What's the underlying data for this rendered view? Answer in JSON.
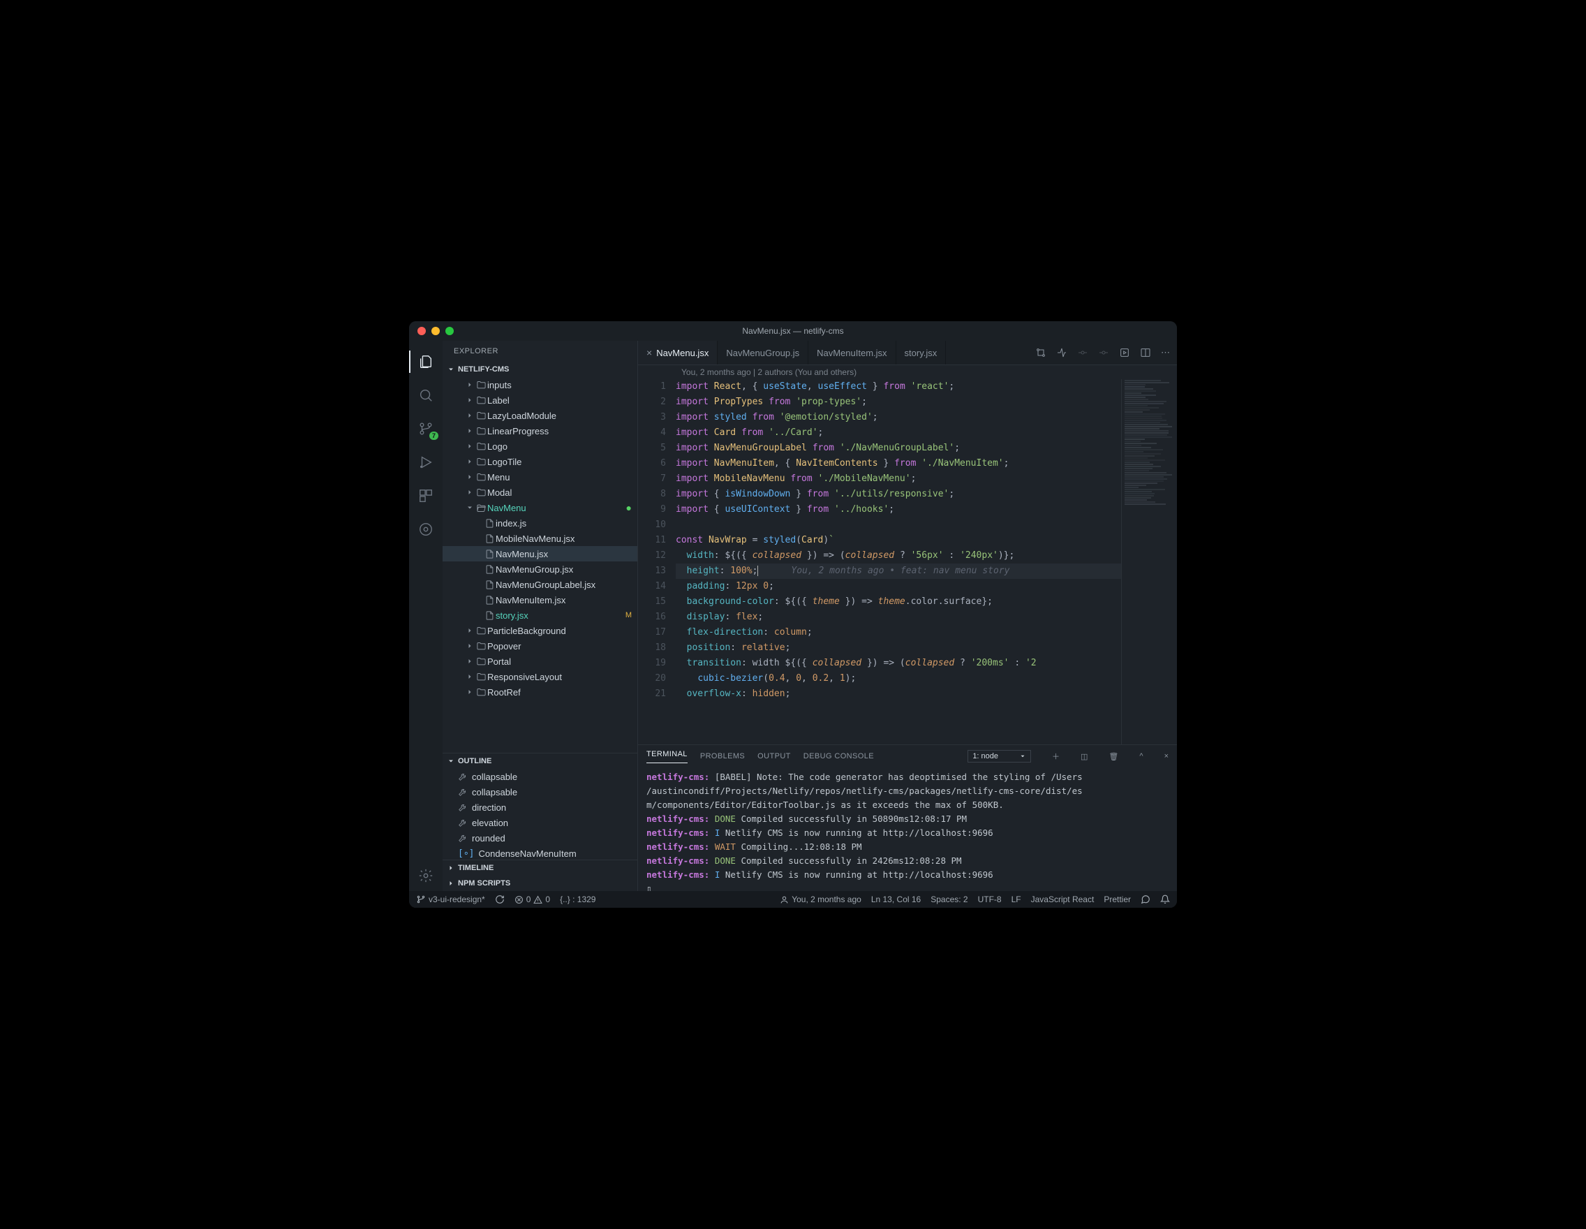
{
  "window": {
    "title": "NavMenu.jsx — netlify-cms"
  },
  "sidebar": {
    "title": "EXPLORER",
    "project": "NETLIFY-CMS",
    "tree": [
      {
        "depth": 2,
        "kind": "folder",
        "label": "inputs",
        "expanded": false,
        "lower": true
      },
      {
        "depth": 2,
        "kind": "folder",
        "label": "Label",
        "expanded": false
      },
      {
        "depth": 2,
        "kind": "folder",
        "label": "LazyLoadModule",
        "expanded": false
      },
      {
        "depth": 2,
        "kind": "folder",
        "label": "LinearProgress",
        "expanded": false
      },
      {
        "depth": 2,
        "kind": "folder",
        "label": "Logo",
        "expanded": false
      },
      {
        "depth": 2,
        "kind": "folder",
        "label": "LogoTile",
        "expanded": false
      },
      {
        "depth": 2,
        "kind": "folder",
        "label": "Menu",
        "expanded": false
      },
      {
        "depth": 2,
        "kind": "folder",
        "label": "Modal",
        "expanded": false
      },
      {
        "depth": 2,
        "kind": "folder",
        "label": "NavMenu",
        "expanded": true,
        "teal": true,
        "dot": true
      },
      {
        "depth": 3,
        "kind": "file",
        "label": "index.js"
      },
      {
        "depth": 3,
        "kind": "file",
        "label": "MobileNavMenu.jsx"
      },
      {
        "depth": 3,
        "kind": "file",
        "label": "NavMenu.jsx",
        "active": true
      },
      {
        "depth": 3,
        "kind": "file",
        "label": "NavMenuGroup.jsx"
      },
      {
        "depth": 3,
        "kind": "file",
        "label": "NavMenuGroupLabel.jsx"
      },
      {
        "depth": 3,
        "kind": "file",
        "label": "NavMenuItem.jsx"
      },
      {
        "depth": 3,
        "kind": "file",
        "label": "story.jsx",
        "teal": true,
        "status": "M"
      },
      {
        "depth": 2,
        "kind": "folder",
        "label": "ParticleBackground",
        "expanded": false
      },
      {
        "depth": 2,
        "kind": "folder",
        "label": "Popover",
        "expanded": false
      },
      {
        "depth": 2,
        "kind": "folder",
        "label": "Portal",
        "expanded": false
      },
      {
        "depth": 2,
        "kind": "folder",
        "label": "ResponsiveLayout",
        "expanded": false
      },
      {
        "depth": 2,
        "kind": "folder",
        "label": "RootRef",
        "expanded": false
      }
    ],
    "outline_title": "OUTLINE",
    "outline": [
      {
        "icon": "wrench",
        "label": "collapsable"
      },
      {
        "icon": "wrench",
        "label": "collapsable"
      },
      {
        "icon": "wrench",
        "label": "direction"
      },
      {
        "icon": "wrench",
        "label": "elevation"
      },
      {
        "icon": "wrench",
        "label": "rounded"
      },
      {
        "icon": "bracket",
        "label": "CondenseNavMenuItem"
      }
    ],
    "timeline": "TIMELINE",
    "npm": "NPM SCRIPTS"
  },
  "activity": {
    "scm_badge": "7"
  },
  "tabs": [
    {
      "label": "NavMenu.jsx",
      "active": true,
      "close": true
    },
    {
      "label": "NavMenuGroup.js",
      "active": false
    },
    {
      "label": "NavMenuItem.jsx",
      "active": false
    },
    {
      "label": "story.jsx",
      "active": false
    }
  ],
  "blame": "You, 2 months ago | 2 authors (You and others)",
  "editor": {
    "inline_blame": "You, 2 months ago • feat: nav menu story",
    "lines": [
      1,
      2,
      3,
      4,
      5,
      6,
      7,
      8,
      9,
      10,
      11,
      12,
      13,
      14,
      15,
      16,
      17,
      18,
      19,
      20,
      21
    ]
  },
  "panel": {
    "tabs": [
      "TERMINAL",
      "PROBLEMS",
      "OUTPUT",
      "DEBUG CONSOLE"
    ],
    "active_tab": "TERMINAL",
    "term_select": "1: node",
    "lines": [
      {
        "tag": "netlify-cms:",
        "cls": "",
        "text": "[BABEL] Note: The code generator has deoptimised the styling of /Users"
      },
      {
        "tag": "",
        "cls": "",
        "text": "/austincondiff/Projects/Netlify/repos/netlify-cms/packages/netlify-cms-core/dist/es"
      },
      {
        "tag": "",
        "cls": "",
        "text": "m/components/Editor/EditorToolbar.js as it exceeds the max of 500KB."
      },
      {
        "tag": "netlify-cms:",
        "cls": "done",
        "text": "DONE  Compiled successfully in 50890ms12:08:17 PM"
      },
      {
        "tag": "netlify-cms:",
        "cls": "info",
        "text": "I  Netlify CMS is now running at http://localhost:9696"
      },
      {
        "tag": "netlify-cms:",
        "cls": "wait",
        "text": "WAIT  Compiling...12:08:18 PM"
      },
      {
        "tag": "netlify-cms:",
        "cls": "done",
        "text": "DONE  Compiled successfully in 2426ms12:08:28 PM"
      },
      {
        "tag": "netlify-cms:",
        "cls": "info",
        "text": "I  Netlify CMS is now running at http://localhost:9696"
      }
    ],
    "prompt": "▯"
  },
  "status": {
    "branch": "v3-ui-redesign*",
    "errors": "0",
    "warnings": "0",
    "bracket": "{..} : 1329",
    "blame": "You, 2 months ago",
    "cursor": "Ln 13, Col 16",
    "spaces": "Spaces: 2",
    "encoding": "UTF-8",
    "eol": "LF",
    "lang": "JavaScript React",
    "formatter": "Prettier"
  }
}
